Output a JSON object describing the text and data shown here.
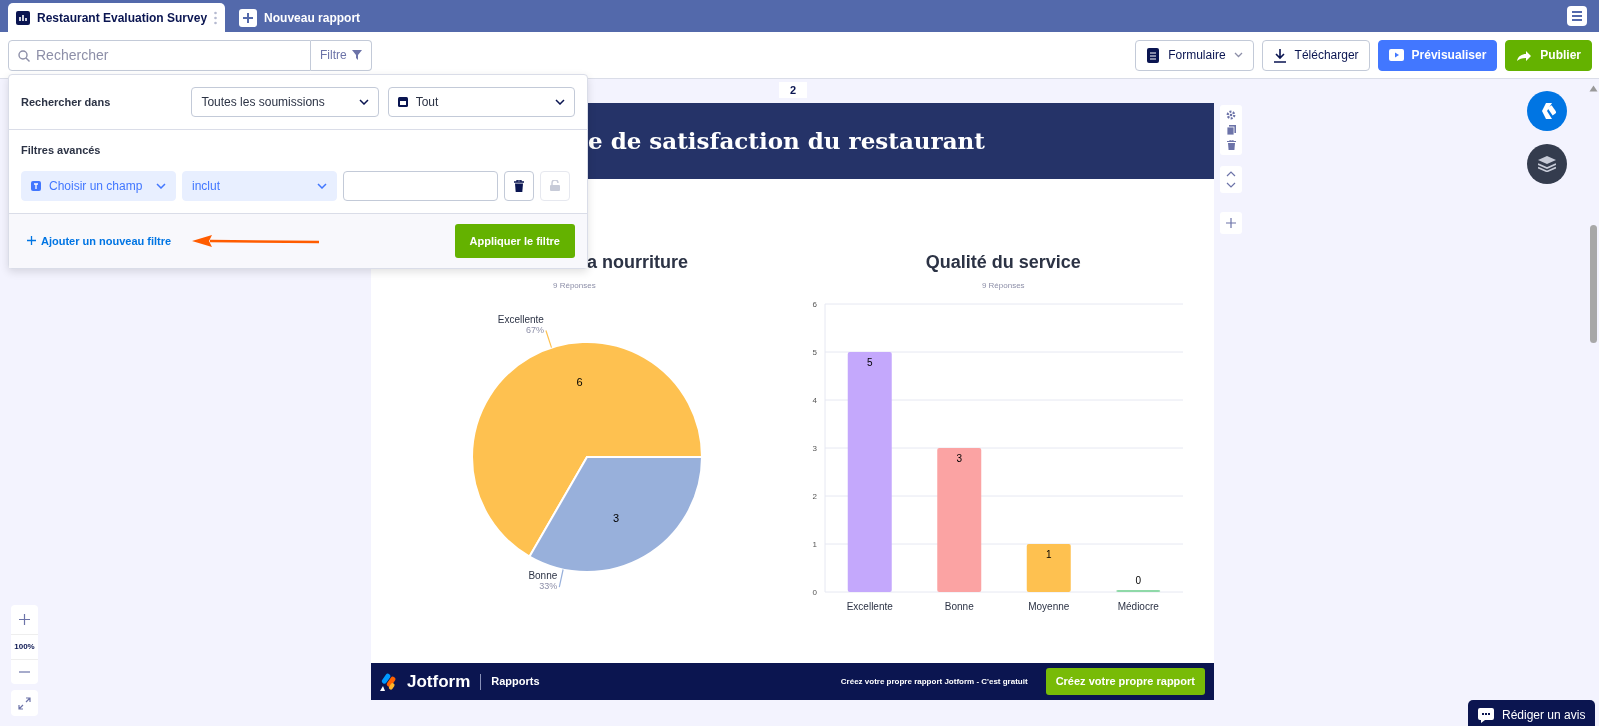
{
  "tabs": [
    {
      "label": "Restaurant Evaluation Survey",
      "selected": true,
      "kind": "report"
    },
    {
      "label": "Nouveau rapport",
      "selected": false,
      "kind": "new"
    }
  ],
  "toolbar": {
    "search": {
      "placeholder": "Rechercher"
    },
    "filter_button": "Filtre",
    "actions": [
      {
        "label": "Formulaire",
        "kind": "dropdown"
      },
      {
        "label": "Télécharger",
        "kind": "download"
      },
      {
        "label": "Prévisualiser",
        "kind": "preview"
      },
      {
        "label": "Publier",
        "kind": "publish"
      }
    ]
  },
  "filter_panel": {
    "search_in_label": "Rechercher dans",
    "scope_select": "Toutes les soumissions",
    "date_select": "Tout",
    "advanced_label": "Filtres avancés",
    "field_select": "Choisir un champ",
    "operator_select": "inclut",
    "add_filter_link": "Ajouter un nouveau filtre",
    "apply_button": "Appliquer le filtre"
  },
  "page": {
    "page_number": "2",
    "title": "e de satisfaction du restaurant",
    "charts": [
      {
        "title": "a nourriture",
        "subtitle": "9 Réponses",
        "chart_data": {
          "type": "pie",
          "categories": [
            "Excellente",
            "Bonne"
          ],
          "values": [
            6,
            3
          ],
          "colors": [
            "#fec150",
            "#98b0db"
          ],
          "value_labels": [
            "6",
            "3"
          ],
          "annotations": [
            "67%",
            "33%"
          ]
        }
      },
      {
        "title": "Qualité du service",
        "subtitle": "9 Réponses",
        "chart_data": {
          "type": "bar",
          "categories": [
            "Excellente",
            "Bonne",
            "Moyenne",
            "Médiocre"
          ],
          "values": [
            5,
            3,
            1,
            0
          ],
          "colors": [
            "#c4a8fc",
            "#fba3a3",
            "#fec150",
            "#8fd9a8"
          ],
          "ylim": [
            0,
            6
          ],
          "grid": true,
          "yticks": [
            0,
            1,
            2,
            3,
            4,
            5,
            6
          ],
          "value_labels": [
            "5",
            "3",
            "1",
            "0"
          ]
        }
      }
    ],
    "footer": {
      "brand": "Jotform",
      "product": "Rapports",
      "promo": "Créez votre propre rapport Jotform - C'est gratuit",
      "button": "Créez votre propre rapport"
    }
  },
  "zoom": {
    "level_label": "100%"
  },
  "review_button": "Rédiger un avis"
}
